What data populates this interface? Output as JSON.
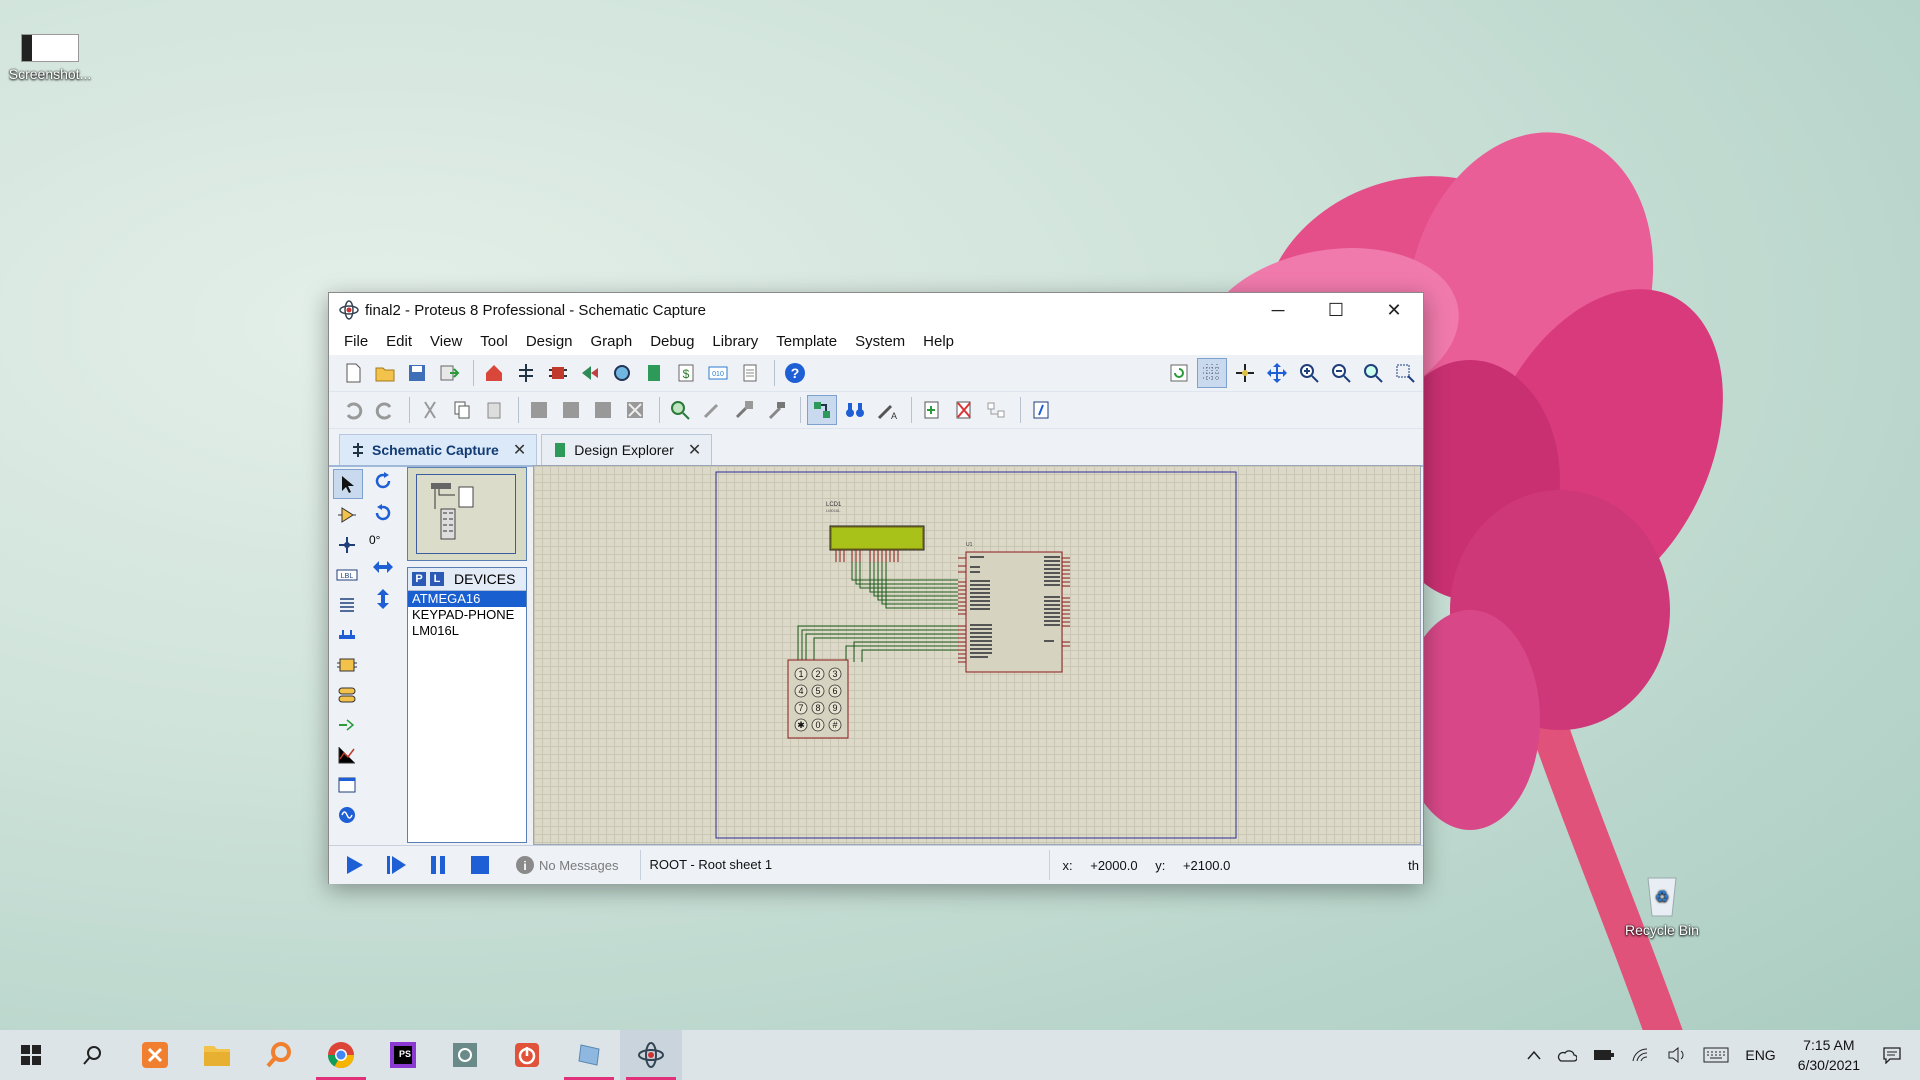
{
  "desktop": {
    "icons": [
      {
        "label": "Screenshot..."
      },
      {
        "label": "Recycle Bin"
      }
    ]
  },
  "window": {
    "title": "final2 - Proteus 8 Professional - Schematic Capture",
    "controls": {
      "minimize": "─",
      "maximize": "☐",
      "close": "✕"
    },
    "menu": [
      "File",
      "Edit",
      "View",
      "Tool",
      "Design",
      "Graph",
      "Debug",
      "Library",
      "Template",
      "System",
      "Help"
    ],
    "tabs": [
      {
        "label": "Schematic Capture",
        "close": "✕"
      },
      {
        "label": "Design Explorer",
        "close": "✕"
      }
    ],
    "angle": "0°",
    "devices": {
      "p": "P",
      "l": "L",
      "header": "DEVICES",
      "items": [
        "ATMEGA16",
        "KEYPAD-PHONE",
        "LM016L"
      ]
    },
    "schematic": {
      "lcd_label": "LCD1",
      "lcd_sub": "LM016L",
      "mcu_label": "U1",
      "keypad_keys": [
        "1",
        "2",
        "3",
        "4",
        "5",
        "6",
        "7",
        "8",
        "9",
        "✱",
        "0",
        "#"
      ]
    },
    "status": {
      "messages": "No Messages",
      "sheet": "ROOT - Root sheet 1",
      "x_label": "x:",
      "x_value": "+2000.0",
      "y_label": "y:",
      "y_value": "+2100.0",
      "units": "th"
    }
  },
  "taskbar": {
    "lang": "ENG",
    "time": "7:15 AM",
    "date": "6/30/2021"
  },
  "colors": {
    "accent": "#e0307a",
    "selection": "#1a5fd0",
    "lcd": "#a8c21a"
  }
}
